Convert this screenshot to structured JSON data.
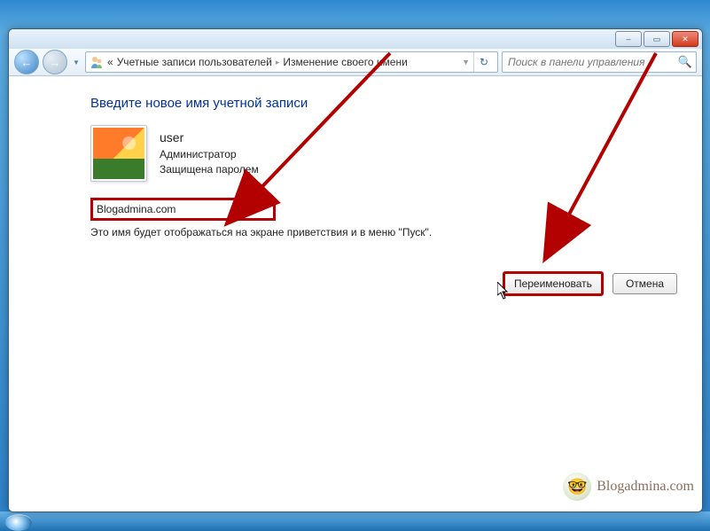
{
  "window": {
    "controls": {
      "minimize": "–",
      "maximize": "▭",
      "close": "✕"
    }
  },
  "toolbar": {
    "back_glyph": "←",
    "forward_glyph": "→",
    "dropdown_glyph": "▼",
    "refresh_glyph": "↻",
    "breadcrumb_prefix": "«",
    "breadcrumb_item1": "Учетные записи пользователей",
    "breadcrumb_item2": "Изменение своего имени",
    "breadcrumb_sep": "▸",
    "search_placeholder": "Поиск в панели управления",
    "search_glyph": "🔍"
  },
  "main": {
    "heading": "Введите новое имя учетной записи",
    "account": {
      "name": "user",
      "role": "Администратор",
      "protection": "Защищена паролем"
    },
    "name_input_value": "Blogadmina.com",
    "helper_text": "Это имя будет отображаться на экране приветствия и в меню \"Пуск\"."
  },
  "buttons": {
    "rename": "Переименовать",
    "cancel": "Отмена"
  },
  "watermark": {
    "text": "Blogadmina.com",
    "badge_glyph": "🤓"
  },
  "colors": {
    "highlight_border": "#b30000",
    "link_heading": "#003399"
  }
}
